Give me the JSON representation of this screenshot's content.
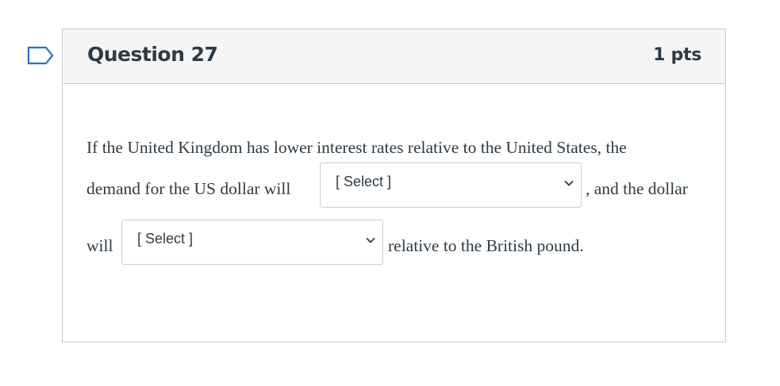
{
  "question": {
    "title": "Question 27",
    "points": "1 pts",
    "text": {
      "line1": "If the United Kingdom has lower interest rates relative to the United States, the",
      "line2_before": "demand for the US dollar will",
      "line2_after": ", and the dollar",
      "line3_before": "will",
      "line3_after": "relative to the British pound."
    },
    "dropdowns": [
      {
        "selected": "[ Select ]",
        "icon": "chevron-down-icon"
      },
      {
        "selected": "[ Select ]",
        "icon": "chevron-down-icon"
      }
    ]
  },
  "flag": {
    "icon": "bookmark-flag-icon",
    "color": "#2d6fbc"
  },
  "colors": {
    "header_bg": "#f5f5f5",
    "border": "#c7cdd1",
    "text": "#2d3b45"
  }
}
